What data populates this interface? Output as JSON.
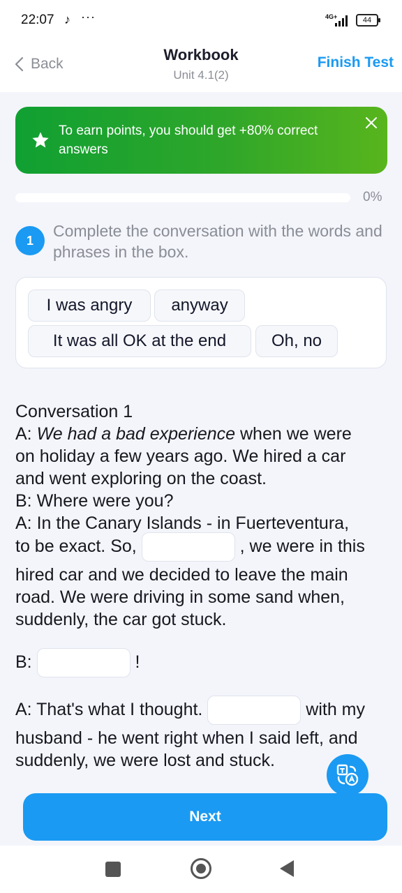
{
  "status": {
    "time": "22:07",
    "icons": [
      "tiktok-icon",
      "more-dots-icon",
      "signal-icon",
      "battery-icon"
    ],
    "network": "4G+",
    "battery": "44"
  },
  "header": {
    "back_label": "Back",
    "title": "Workbook",
    "subtitle": "Unit 4.1(2)",
    "finish_label": "Finish Test"
  },
  "banner": {
    "text": "To earn points, you should get +80% correct answers",
    "color_start": "#10a032",
    "color_end": "#58b51d"
  },
  "progress": {
    "value": 0,
    "label": "0%"
  },
  "question": {
    "number": "1",
    "text": "Complete the conversation with the words and phrases in the box."
  },
  "word_box": {
    "chips": [
      "I was angry",
      "anyway",
      "It was all OK at the end",
      "Oh, no"
    ]
  },
  "conversation": {
    "heading": "Conversation 1",
    "a1_prefix": "A: ",
    "a1_italic": "We had a bad experience",
    "a1_rest": " when we were",
    "a1_line2": "on holiday a few years ago. We hired a car",
    "a1_line3": "and went exploring on the coast.",
    "b1": "B: Where were you?",
    "a2_line1": "A: In the Canary Islands - in Fuerteventura,",
    "a2_before_blank": "to be exact. So, ",
    "a2_after_blank": " , we were in this",
    "a2_line3": "hired car and we decided to leave the main",
    "a2_line4": "road. We were driving in some sand when,",
    "a2_line5": "suddenly, the car got stuck.",
    "b2_prefix": "B: ",
    "b2_suffix": " !",
    "a3_before_blank": "A: That's what I thought. ",
    "a3_after_blank": " with my",
    "a3_line2": "husband - he went right when I said left, and",
    "a3_line3": "suddenly, we were lost and stuck."
  },
  "actions": {
    "next_label": "Next",
    "accent_color": "#1a9af2"
  }
}
